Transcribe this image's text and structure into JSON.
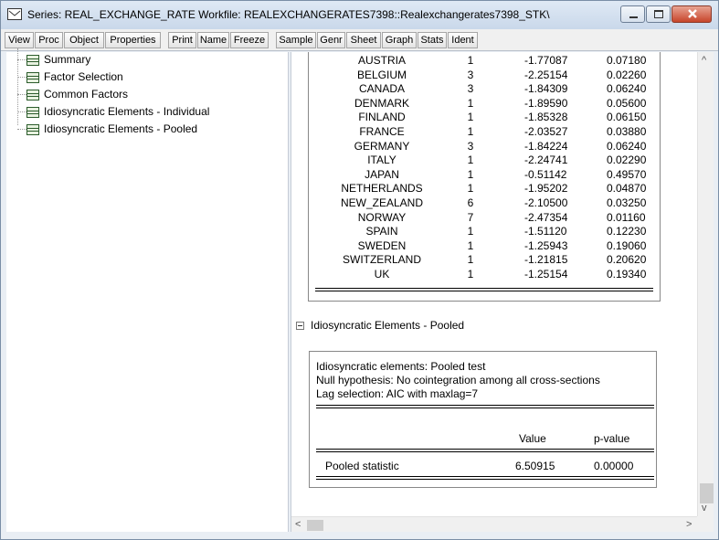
{
  "window": {
    "title": "Series: REAL_EXCHANGE_RATE   Workfile: REALEXCHANGERATES7398::Realexchangerates7398_STK\\"
  },
  "toolbar": {
    "buttons": [
      "View",
      "Proc",
      "Object",
      "Properties",
      "Print",
      "Name",
      "Freeze",
      "Sample",
      "Genr",
      "Sheet",
      "Graph",
      "Stats",
      "Ident"
    ]
  },
  "tree": {
    "items": [
      "Summary",
      "Factor Selection",
      "Common Factors",
      "Idiosyncratic Elements - Individual",
      "Idiosyncratic Elements - Pooled"
    ]
  },
  "individual_table": {
    "rows": [
      [
        "AUSTRIA",
        "1",
        "-1.77087",
        "0.07180"
      ],
      [
        "BELGIUM",
        "3",
        "-2.25154",
        "0.02260"
      ],
      [
        "CANADA",
        "3",
        "-1.84309",
        "0.06240"
      ],
      [
        "DENMARK",
        "1",
        "-1.89590",
        "0.05600"
      ],
      [
        "FINLAND",
        "1",
        "-1.85328",
        "0.06150"
      ],
      [
        "FRANCE",
        "1",
        "-2.03527",
        "0.03880"
      ],
      [
        "GERMANY",
        "3",
        "-1.84224",
        "0.06240"
      ],
      [
        "ITALY",
        "1",
        "-2.24741",
        "0.02290"
      ],
      [
        "JAPAN",
        "1",
        "-0.51142",
        "0.49570"
      ],
      [
        "NETHERLANDS",
        "1",
        "-1.95202",
        "0.04870"
      ],
      [
        "NEW_ZEALAND",
        "6",
        "-2.10500",
        "0.03250"
      ],
      [
        "NORWAY",
        "7",
        "-2.47354",
        "0.01160"
      ],
      [
        "SPAIN",
        "1",
        "-1.51120",
        "0.12230"
      ],
      [
        "SWEDEN",
        "1",
        "-1.25943",
        "0.19060"
      ],
      [
        "SWITZERLAND",
        "1",
        "-1.21815",
        "0.20620"
      ],
      [
        "UK",
        "1",
        "-1.25154",
        "0.19340"
      ]
    ]
  },
  "pooled_section": {
    "title": "Idiosyncratic Elements - Pooled",
    "lines": [
      "Idiosyncratic elements: Pooled test",
      "Null hypothesis: No cointegration among all cross-sections",
      "Lag selection: AIC with maxlag=7"
    ],
    "columns": [
      "Value",
      "p-value"
    ],
    "stat_label": "Pooled statistic",
    "stat_value": "6.50915",
    "stat_pvalue": "0.00000"
  },
  "scroll": {
    "up": "^",
    "down": "v",
    "left": "<",
    "right": ">"
  }
}
